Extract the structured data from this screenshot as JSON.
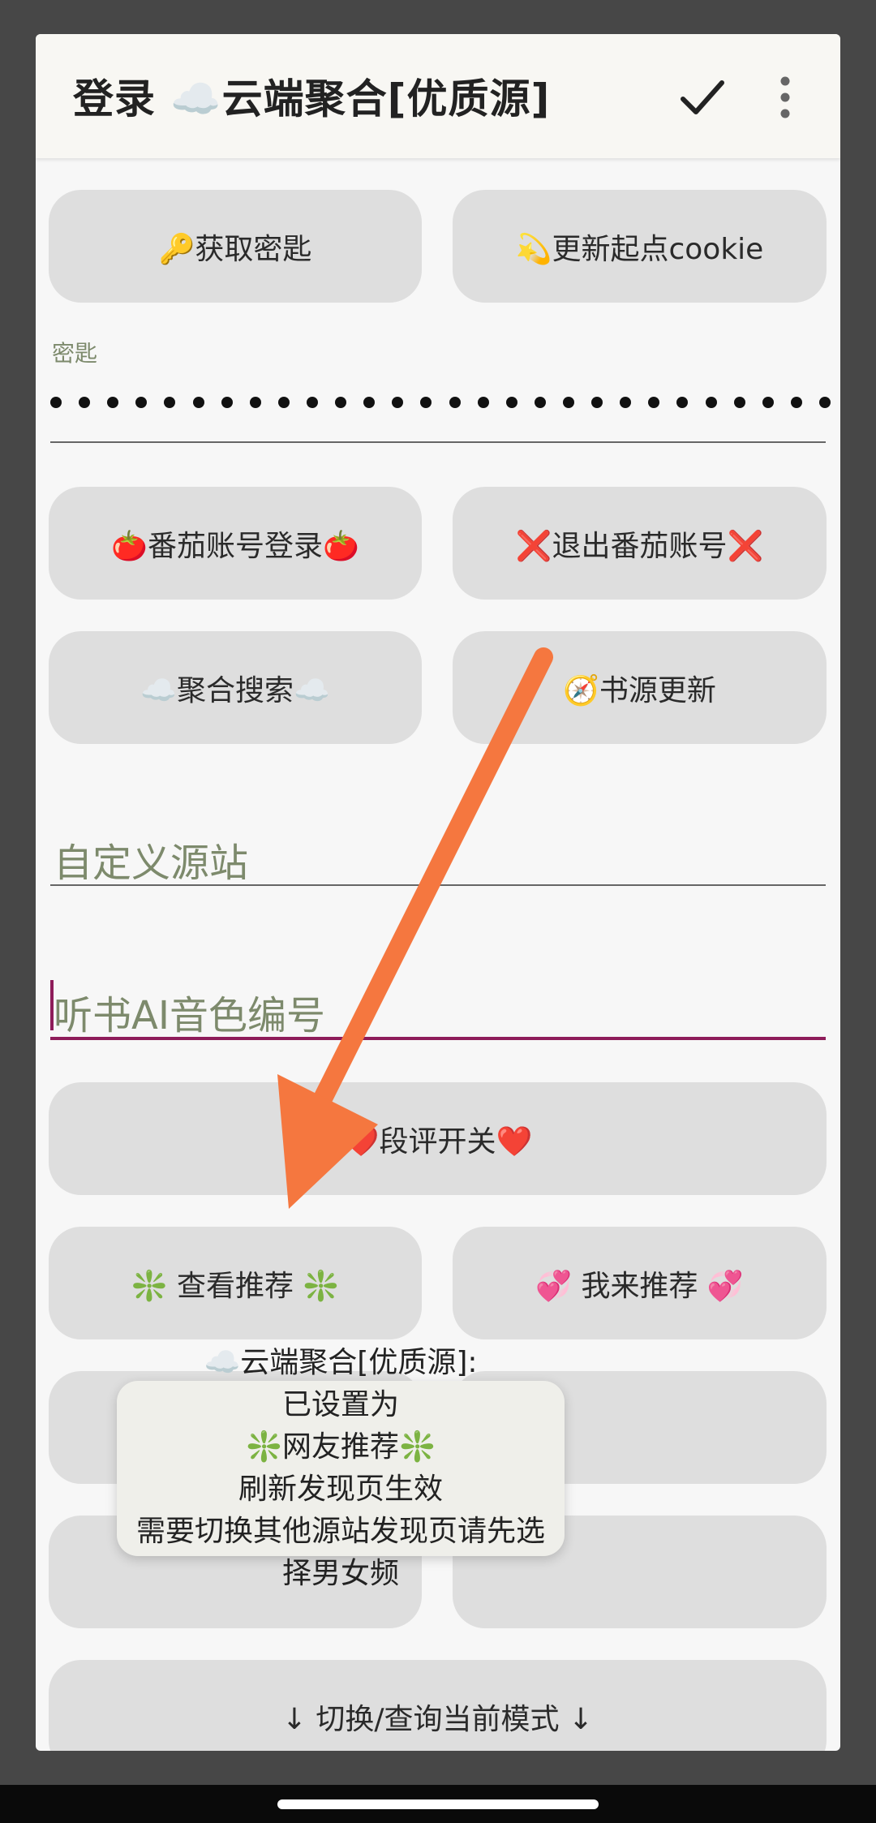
{
  "titlebar": {
    "title": "登录 ☁️云端聚合[优质源]",
    "confirm_icon": "check-icon",
    "menu_icon": "more-vertical-icon"
  },
  "buttons": {
    "get_key": "🔑获取密匙",
    "update_cookie": "💫更新起点cookie",
    "tomato_login": "🍅番茄账号登录🍅",
    "tomato_logout": "❌退出番茄账号❌",
    "agg_search": "☁️聚合搜索☁️",
    "source_update": "🧭书源更新",
    "comment_toggle": "❤️段评开关❤️",
    "view_recommend": "❇️ 查看推荐 ❇️",
    "my_recommend": "💞 我来推荐 💞",
    "switch_mode": "↓   切换/查询当前模式   ↓"
  },
  "key_field": {
    "label": "密匙",
    "masked_length": 28
  },
  "custom_source": {
    "placeholder": "自定义源站"
  },
  "tts_voice": {
    "placeholder": "听书AI音色编号"
  },
  "toast": {
    "lines": [
      "☁️云端聚合[优质源]:",
      "已设置为",
      "❇️网友推荐❇️",
      "刷新发现页生效",
      "需要切换其他源站发现页请先选择男女频"
    ]
  },
  "colors": {
    "accent": "#8e1c5a",
    "hint_text": "#7d8a6c",
    "button_bg": "#dedede",
    "annotation_arrow": "#f5773f"
  }
}
